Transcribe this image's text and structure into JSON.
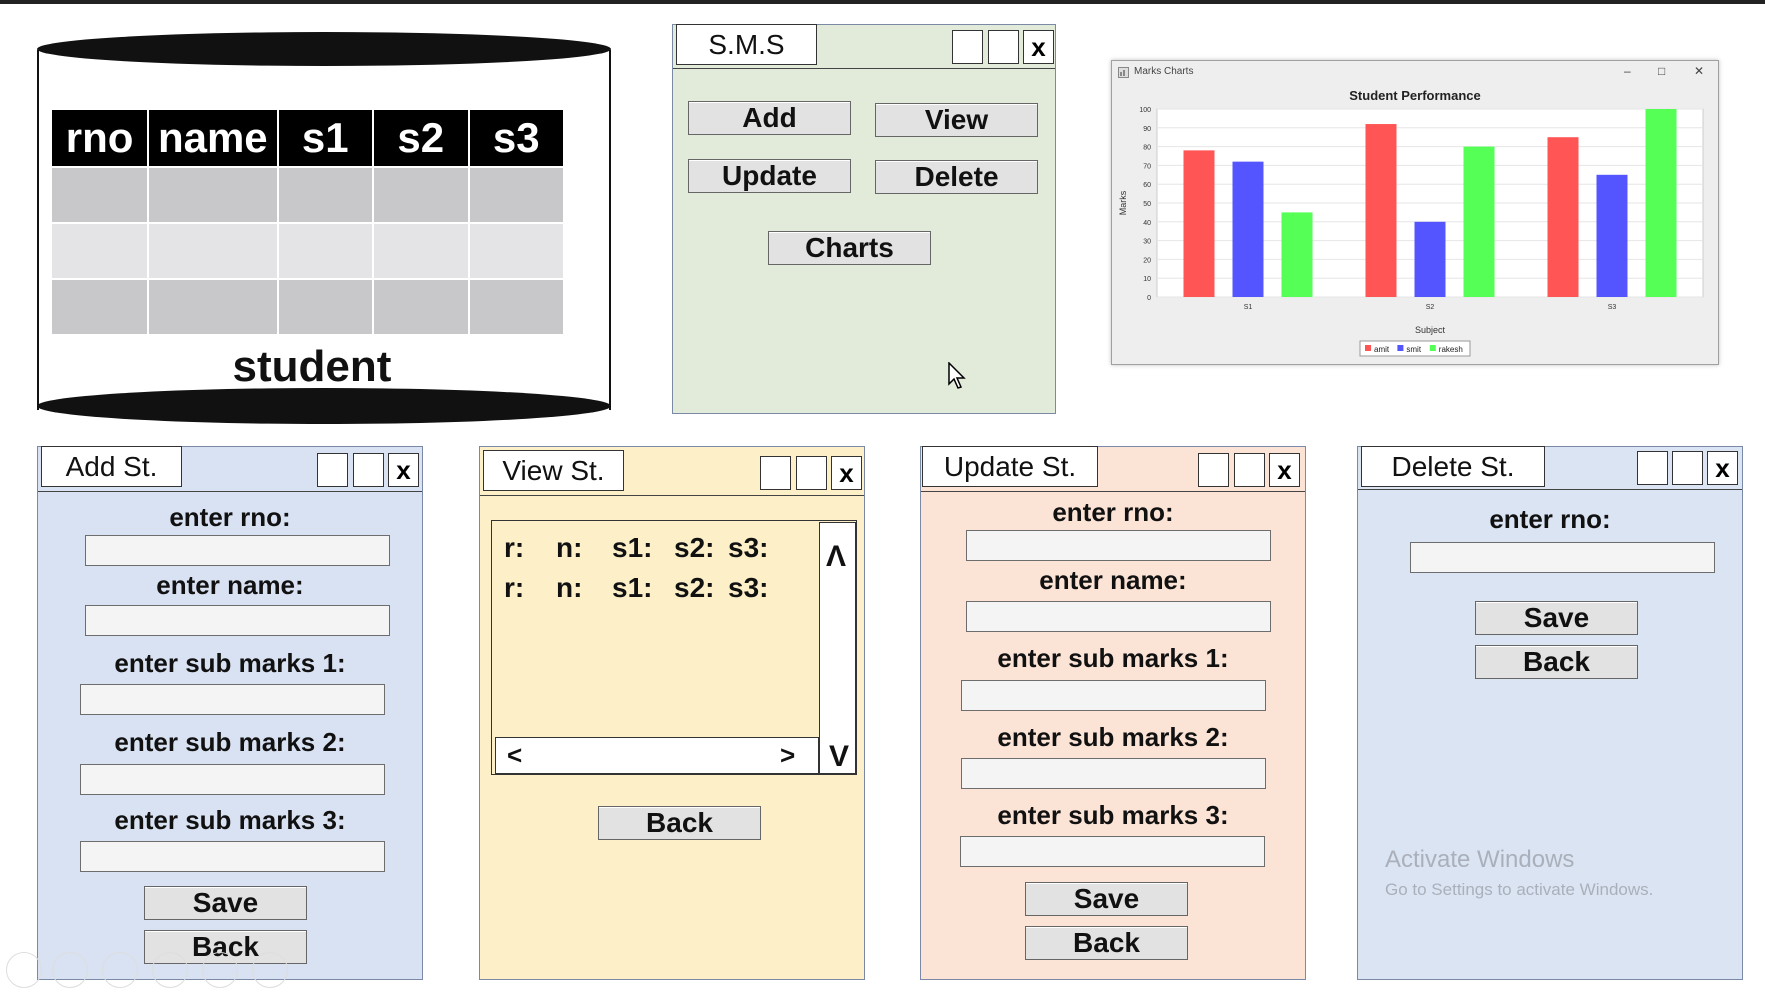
{
  "database": {
    "columns": [
      "rno",
      "name",
      "s1",
      "s2",
      "s3"
    ],
    "table_name": "student"
  },
  "sms_window": {
    "title": "S.M.S",
    "close": "x",
    "buttons": {
      "add": "Add",
      "view": "View",
      "update": "Update",
      "delete": "Delete",
      "charts": "Charts"
    }
  },
  "chart_window": {
    "title": "Marks Charts",
    "minimize": "–",
    "maximize": "□",
    "close": "✕"
  },
  "chart_data": {
    "type": "bar",
    "title": "Student Performance",
    "xlabel": "Subject",
    "ylabel": "Marks",
    "categories": [
      "S1",
      "S2",
      "S3"
    ],
    "ylim": [
      0,
      100
    ],
    "yticks": [
      0,
      10,
      20,
      30,
      40,
      50,
      60,
      70,
      80,
      90,
      100
    ],
    "grid": true,
    "legend_position": "bottom",
    "series": [
      {
        "name": "amit",
        "color": "#ff5555",
        "values": [
          78,
          92,
          85
        ]
      },
      {
        "name": "smit",
        "color": "#5555ff",
        "values": [
          72,
          40,
          65
        ]
      },
      {
        "name": "rakesh",
        "color": "#55ff55",
        "values": [
          45,
          80,
          100
        ]
      }
    ]
  },
  "add_window": {
    "title": "Add St.",
    "close": "x",
    "labels": [
      "enter rno:",
      "enter name:",
      "enter sub marks 1:",
      "enter sub marks 2:",
      "enter sub marks 3:"
    ],
    "save": "Save",
    "back": "Back"
  },
  "view_window": {
    "title": "View St.",
    "close": "x",
    "rows": [
      [
        "r:",
        "n:",
        "s1:",
        "s2:",
        "s3:"
      ],
      [
        "r:",
        "n:",
        "s1:",
        "s2:",
        "s3:"
      ]
    ],
    "scroll_up": "Λ",
    "scroll_down": "V",
    "scroll_left": "<",
    "scroll_right": ">",
    "back": "Back"
  },
  "update_window": {
    "title": "Update St.",
    "close": "x",
    "labels": [
      "enter rno:",
      "enter name:",
      "enter sub marks 1:",
      "enter sub marks 2:",
      "enter sub marks 3:"
    ],
    "save": "Save",
    "back": "Back"
  },
  "delete_window": {
    "title": "Delete St.",
    "close": "x",
    "label": "enter rno:",
    "save": "Save",
    "back": "Back"
  },
  "watermark": {
    "line1": "Activate Windows",
    "line2": "Go to Settings to activate Windows."
  }
}
